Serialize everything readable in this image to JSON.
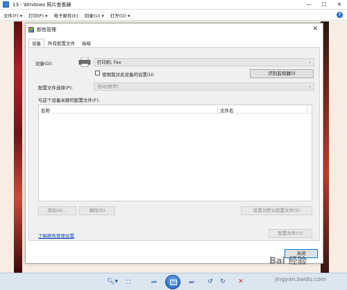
{
  "window": {
    "title": "13 - Windows 照片查看器",
    "controls": [
      "—",
      "☐",
      "✕"
    ]
  },
  "menubar": {
    "items": [
      "文件(F) ▾",
      "打印(P) ▾",
      "电子邮件(E)",
      "刻录(U) ▾",
      "打开(O) ▾"
    ],
    "help": "?"
  },
  "dialog": {
    "title": "颜色管理",
    "close": "✕",
    "tabs": [
      "设备",
      "所有配置文件",
      "高级"
    ],
    "device_label": "设备(D):",
    "device_value": "打印机: Fax",
    "use_settings_label": "使用我对此设备的设置(U)",
    "identify_button": "识别监视器(I)",
    "profile_select_label": "配置文件选择(P):",
    "profile_select_value": "自动(推荐)",
    "assoc_label": "与这个设备关联的配置文件(F):",
    "columns": [
      "名称",
      "文件名"
    ],
    "add_button": "添加(A)...",
    "remove_button": "删除(R)",
    "set_default_button": "设置为默认配置文件(S)",
    "learn_link": "了解颜色管理设置",
    "profiles_button": "配置文件(O)",
    "close_button": "关闭"
  },
  "watermark": {
    "logo": "Bai 经验",
    "url": "jingyan.baidu.com"
  },
  "colors": {
    "accent": "#0078d7",
    "toolbar": "#dbe6f1",
    "photo_bg": "#f7ede2"
  }
}
